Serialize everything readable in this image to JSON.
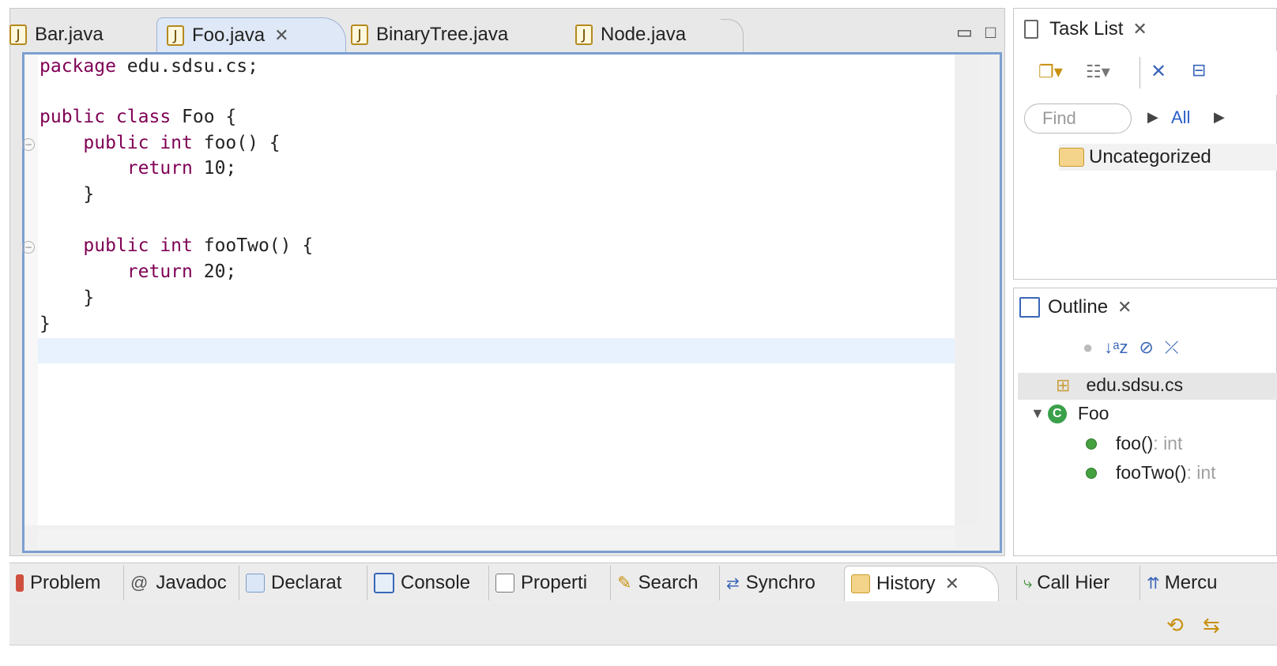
{
  "editor": {
    "tabs": [
      {
        "label": "Bar.java"
      },
      {
        "label": "Foo.java",
        "active": true
      },
      {
        "label": "BinaryTree.java"
      },
      {
        "label": "Node.java"
      }
    ],
    "code_lines": [
      {
        "kw": "package",
        "rest": " edu.sdsu.cs;"
      },
      {
        "kw": "",
        "rest": ""
      },
      {
        "kw": "public class",
        "rest": " Foo {"
      },
      {
        "kw": "    public int",
        "rest": " foo() {"
      },
      {
        "kw": "        return",
        "rest": " 10;"
      },
      {
        "kw": "",
        "rest": "    }"
      },
      {
        "kw": "",
        "rest": ""
      },
      {
        "kw": "    public int",
        "rest": " fooTwo() {"
      },
      {
        "kw": "        return",
        "rest": " 20;"
      },
      {
        "kw": "",
        "rest": "    }"
      },
      {
        "kw": "",
        "rest": "}"
      }
    ]
  },
  "task_list": {
    "title": "Task List",
    "find_placeholder": "Find",
    "all_label": "All",
    "category": "Uncategorized"
  },
  "outline": {
    "title": "Outline",
    "package": "edu.sdsu.cs",
    "class_name": "Foo",
    "members": [
      {
        "name": "foo()",
        "type": " : int"
      },
      {
        "name": "fooTwo()",
        "type": " : int"
      }
    ]
  },
  "bottom_tabs": [
    {
      "label": "Problem",
      "icon": "problems-icon"
    },
    {
      "label": "Javadoc",
      "icon": "javadoc-icon"
    },
    {
      "label": "Declarat",
      "icon": "declaration-icon"
    },
    {
      "label": "Console",
      "icon": "console-icon"
    },
    {
      "label": "Properti",
      "icon": "properties-icon"
    },
    {
      "label": "Search",
      "icon": "search-icon"
    },
    {
      "label": "Synchro",
      "icon": "synchronize-icon"
    },
    {
      "label": "History",
      "icon": "history-icon",
      "active": true
    },
    {
      "label": "Call Hier",
      "icon": "call-hierarchy-icon"
    },
    {
      "label": "Mercu",
      "icon": "mercurial-icon"
    }
  ],
  "colors": {
    "keyword": "#7f0055",
    "active_border": "#7b9fd1",
    "current_line": "#e8f2fe"
  }
}
